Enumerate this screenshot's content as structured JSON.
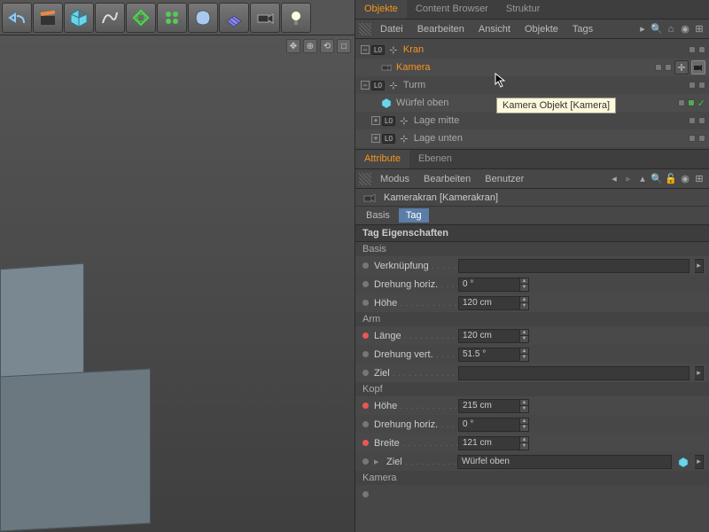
{
  "tabs": {
    "objekte": "Objekte",
    "content": "Content Browser",
    "struktur": "Struktur"
  },
  "obj_menu": [
    "Datei",
    "Bearbeiten",
    "Ansicht",
    "Objekte",
    "Tags"
  ],
  "tree": {
    "kran": "Kran",
    "kamera": "Kamera",
    "turm": "Turm",
    "wuerfel_oben": "Würfel oben",
    "lage_mitte": "Lage mitte",
    "lage_unten": "Lage unten",
    "layer": "L0"
  },
  "tooltip": "Kamera Objekt [Kamera]",
  "attr": {
    "tab_attr": "Attribute",
    "tab_ebenen": "Ebenen",
    "menu": [
      "Modus",
      "Bearbeiten",
      "Benutzer"
    ],
    "title": "Kamerakran [Kamerakran]",
    "sub_basis": "Basis",
    "sub_tag": "Tag",
    "section": "Tag Eigenschaften",
    "groups": {
      "basis": "Basis",
      "arm": "Arm",
      "kopf": "Kopf",
      "kamera": "Kamera"
    },
    "props": {
      "verknuepfung": "Verknüpfung",
      "drehung_horiz": "Drehung horiz.",
      "hoehe": "Höhe",
      "laenge": "Länge",
      "drehung_vert": "Drehung vert.",
      "ziel": "Ziel",
      "breite": "Breite"
    },
    "vals": {
      "dh1": "0 °",
      "h1": "120 cm",
      "len": "120 cm",
      "dv": "51.5 °",
      "kh": "215 cm",
      "kdh": "0 °",
      "kb": "121 cm",
      "kziel": "Würfel oben"
    }
  }
}
